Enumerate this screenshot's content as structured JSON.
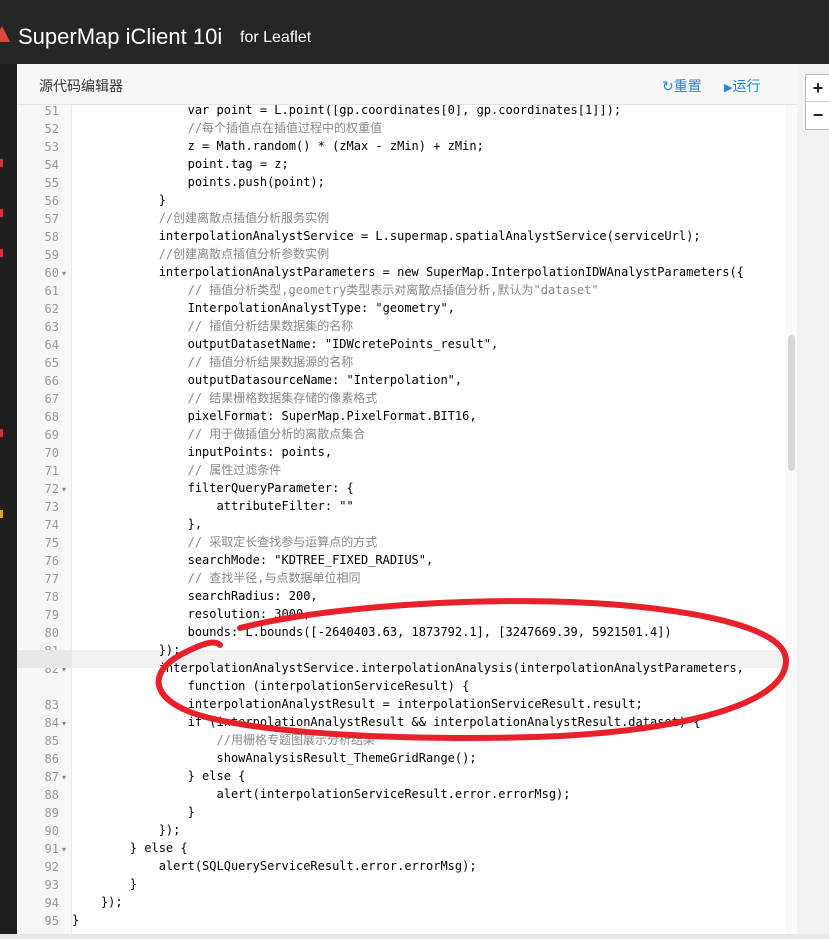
{
  "app": {
    "title": "SuperMap iClient 10i",
    "subtitle": "for Leaflet"
  },
  "editor": {
    "title": "源代码编辑器",
    "reset_icon": "↻",
    "reset_label": "重置",
    "run_icon": "▶",
    "run_label": "运行"
  },
  "map": {
    "zoom_in": "+",
    "zoom_out": "−"
  },
  "annotation_color": "#e8202a",
  "code_lines": [
    {
      "num": "51",
      "text": "                var point = L.point([gp.coordinates[0], gp.coordinates[1]]);",
      "comment": false
    },
    {
      "num": "52",
      "text": "                //每个插值点在插值过程中的权重值",
      "comment": true
    },
    {
      "num": "53",
      "text": "                z = Math.random() * (zMax - zMin) + zMin;",
      "comment": false
    },
    {
      "num": "54",
      "text": "                point.tag = z;",
      "comment": false
    },
    {
      "num": "55",
      "text": "                points.push(point);",
      "comment": false
    },
    {
      "num": "56",
      "text": "            }",
      "comment": false
    },
    {
      "num": "57",
      "text": "            //创建离散点插值分析服务实例",
      "comment": true
    },
    {
      "num": "58",
      "text": "            interpolationAnalystService = L.supermap.spatialAnalystService(serviceUrl);",
      "comment": false
    },
    {
      "num": "59",
      "text": "            //创建离散点插值分析参数实例",
      "comment": true
    },
    {
      "num": "60",
      "text": "            interpolationAnalystParameters = new SuperMap.InterpolationIDWAnalystParameters({",
      "comment": false,
      "fold": true
    },
    {
      "num": "61",
      "text": "                // 插值分析类型,geometry类型表示对离散点插值分析,默认为\"dataset\"",
      "comment": true
    },
    {
      "num": "62",
      "text": "                InterpolationAnalystType: \"geometry\",",
      "comment": false
    },
    {
      "num": "63",
      "text": "                // 插值分析结果数据集的名称",
      "comment": true
    },
    {
      "num": "64",
      "text": "                outputDatasetName: \"IDWcretePoints_result\",",
      "comment": false
    },
    {
      "num": "65",
      "text": "                // 插值分析结果数据源的名称",
      "comment": true
    },
    {
      "num": "66",
      "text": "                outputDatasourceName: \"Interpolation\",",
      "comment": false
    },
    {
      "num": "67",
      "text": "                // 结果栅格数据集存储的像素格式",
      "comment": true
    },
    {
      "num": "68",
      "text": "                pixelFormat: SuperMap.PixelFormat.BIT16,",
      "comment": false
    },
    {
      "num": "69",
      "text": "                // 用于做插值分析的离散点集合",
      "comment": true
    },
    {
      "num": "70",
      "text": "                inputPoints: points,",
      "comment": false
    },
    {
      "num": "71",
      "text": "                // 属性过滤条件",
      "comment": true
    },
    {
      "num": "72",
      "text": "                filterQueryParameter: {",
      "comment": false,
      "fold": true
    },
    {
      "num": "73",
      "text": "                    attributeFilter: \"\"",
      "comment": false
    },
    {
      "num": "74",
      "text": "                },",
      "comment": false
    },
    {
      "num": "75",
      "text": "                // 采取定长查找参与运算点的方式",
      "comment": true
    },
    {
      "num": "76",
      "text": "                searchMode: \"KDTREE_FIXED_RADIUS\",",
      "comment": false
    },
    {
      "num": "77",
      "text": "                // 查找半径,与点数据单位相同",
      "comment": true
    },
    {
      "num": "78",
      "text": "                searchRadius: 200,",
      "comment": false
    },
    {
      "num": "79",
      "text": "                resolution: 3000,",
      "comment": false
    },
    {
      "num": "80",
      "text": "                bounds: L.bounds([-2640403.63, 1873792.1], [3247669.39, 5921501.4])",
      "comment": false
    },
    {
      "num": "81",
      "text": "            });",
      "comment": false
    },
    {
      "num": "82",
      "text": "            interpolationAnalystService.interpolationAnalysis(interpolationAnalystParameters,",
      "comment": false,
      "fold": true
    },
    {
      "num": "",
      "text": "                function (interpolationServiceResult) {",
      "comment": false
    },
    {
      "num": "83",
      "text": "                interpolationAnalystResult = interpolationServiceResult.result;",
      "comment": false
    },
    {
      "num": "84",
      "text": "                if (interpolationAnalystResult && interpolationAnalystResult.dataset) {",
      "comment": false,
      "fold": true
    },
    {
      "num": "85",
      "text": "                    //用栅格专题图展示分析结果",
      "comment": true
    },
    {
      "num": "86",
      "text": "                    showAnalysisResult_ThemeGridRange();",
      "comment": false
    },
    {
      "num": "87",
      "text": "                } else {",
      "comment": false,
      "fold": true
    },
    {
      "num": "88",
      "text": "                    alert(interpolationServiceResult.error.errorMsg);",
      "comment": false
    },
    {
      "num": "89",
      "text": "                }",
      "comment": false
    },
    {
      "num": "90",
      "text": "            });",
      "comment": false
    },
    {
      "num": "91",
      "text": "        } else {",
      "comment": false,
      "fold": true
    },
    {
      "num": "92",
      "text": "            alert(SQLQueryServiceResult.error.errorMsg);",
      "comment": false
    },
    {
      "num": "93",
      "text": "        }",
      "comment": false
    },
    {
      "num": "94",
      "text": "    });",
      "comment": false
    },
    {
      "num": "95",
      "text": "}",
      "comment": false
    }
  ]
}
